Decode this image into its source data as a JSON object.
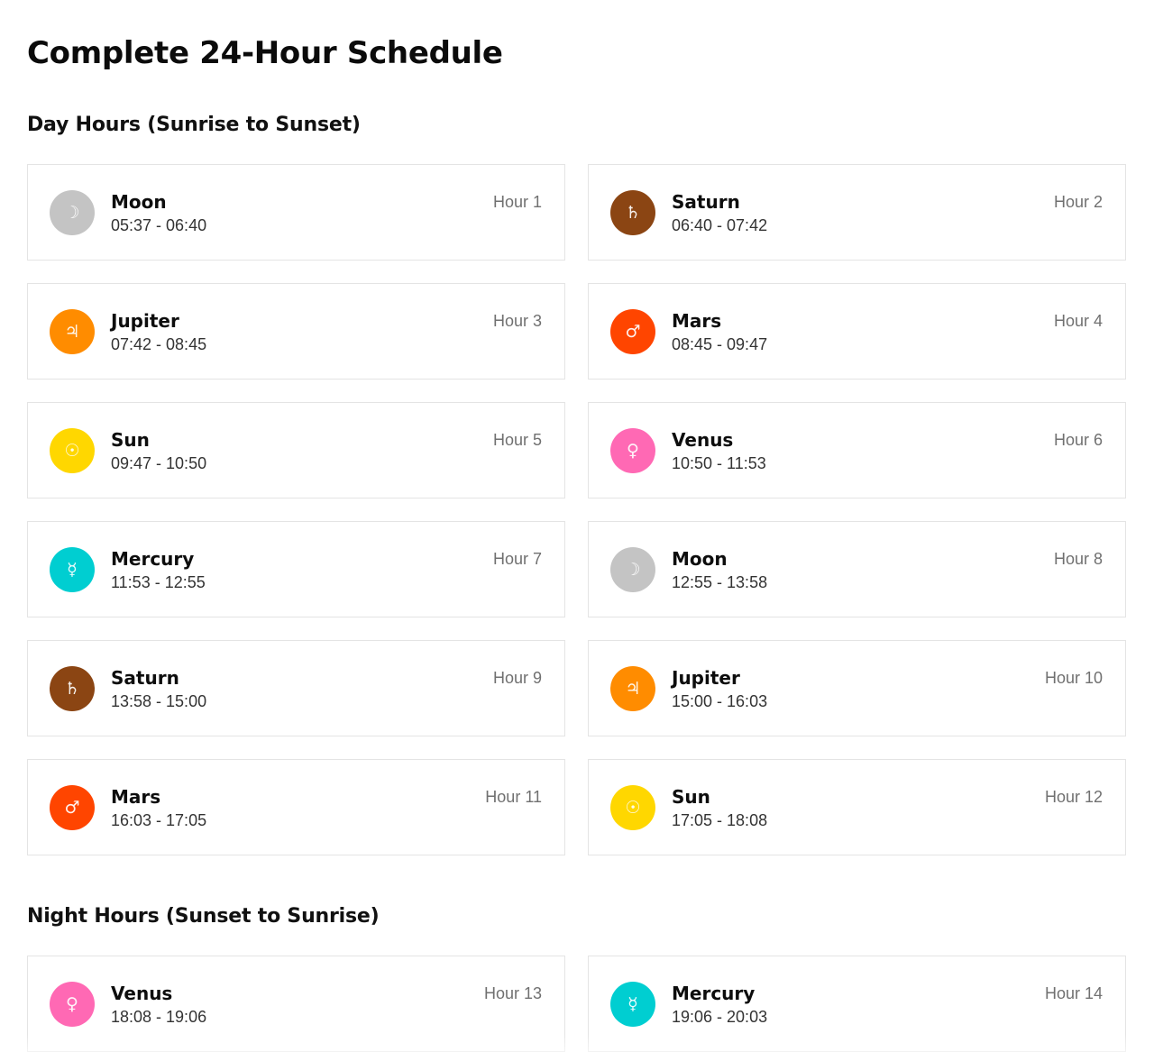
{
  "page_title": "Complete 24-Hour Schedule",
  "sections": [
    {
      "title": "Day Hours (Sunrise to Sunset)",
      "hours": [
        {
          "planet": "Moon",
          "symbol": "☽",
          "color": "#c4c4c4",
          "time": "05:37 - 06:40",
          "hour": "Hour 1"
        },
        {
          "planet": "Saturn",
          "symbol": "♄",
          "color": "#8b4513",
          "time": "06:40 - 07:42",
          "hour": "Hour 2"
        },
        {
          "planet": "Jupiter",
          "symbol": "♃",
          "color": "#ff8c00",
          "time": "07:42 - 08:45",
          "hour": "Hour 3"
        },
        {
          "planet": "Mars",
          "symbol": "♂",
          "color": "#ff4500",
          "time": "08:45 - 09:47",
          "hour": "Hour 4"
        },
        {
          "planet": "Sun",
          "symbol": "☉",
          "color": "#ffd700",
          "time": "09:47 - 10:50",
          "hour": "Hour 5"
        },
        {
          "planet": "Venus",
          "symbol": "♀",
          "color": "#ff69b4",
          "time": "10:50 - 11:53",
          "hour": "Hour 6"
        },
        {
          "planet": "Mercury",
          "symbol": "☿",
          "color": "#00ced1",
          "time": "11:53 - 12:55",
          "hour": "Hour 7"
        },
        {
          "planet": "Moon",
          "symbol": "☽",
          "color": "#c4c4c4",
          "time": "12:55 - 13:58",
          "hour": "Hour 8"
        },
        {
          "planet": "Saturn",
          "symbol": "♄",
          "color": "#8b4513",
          "time": "13:58 - 15:00",
          "hour": "Hour 9"
        },
        {
          "planet": "Jupiter",
          "symbol": "♃",
          "color": "#ff8c00",
          "time": "15:00 - 16:03",
          "hour": "Hour 10"
        },
        {
          "planet": "Mars",
          "symbol": "♂",
          "color": "#ff4500",
          "time": "16:03 - 17:05",
          "hour": "Hour 11"
        },
        {
          "planet": "Sun",
          "symbol": "☉",
          "color": "#ffd700",
          "time": "17:05 - 18:08",
          "hour": "Hour 12"
        }
      ]
    },
    {
      "title": "Night Hours (Sunset to Sunrise)",
      "hours": [
        {
          "planet": "Venus",
          "symbol": "♀",
          "color": "#ff69b4",
          "time": "18:08 - 19:06",
          "hour": "Hour 13"
        },
        {
          "planet": "Mercury",
          "symbol": "☿",
          "color": "#00ced1",
          "time": "19:06 - 20:03",
          "hour": "Hour 14"
        }
      ]
    }
  ]
}
